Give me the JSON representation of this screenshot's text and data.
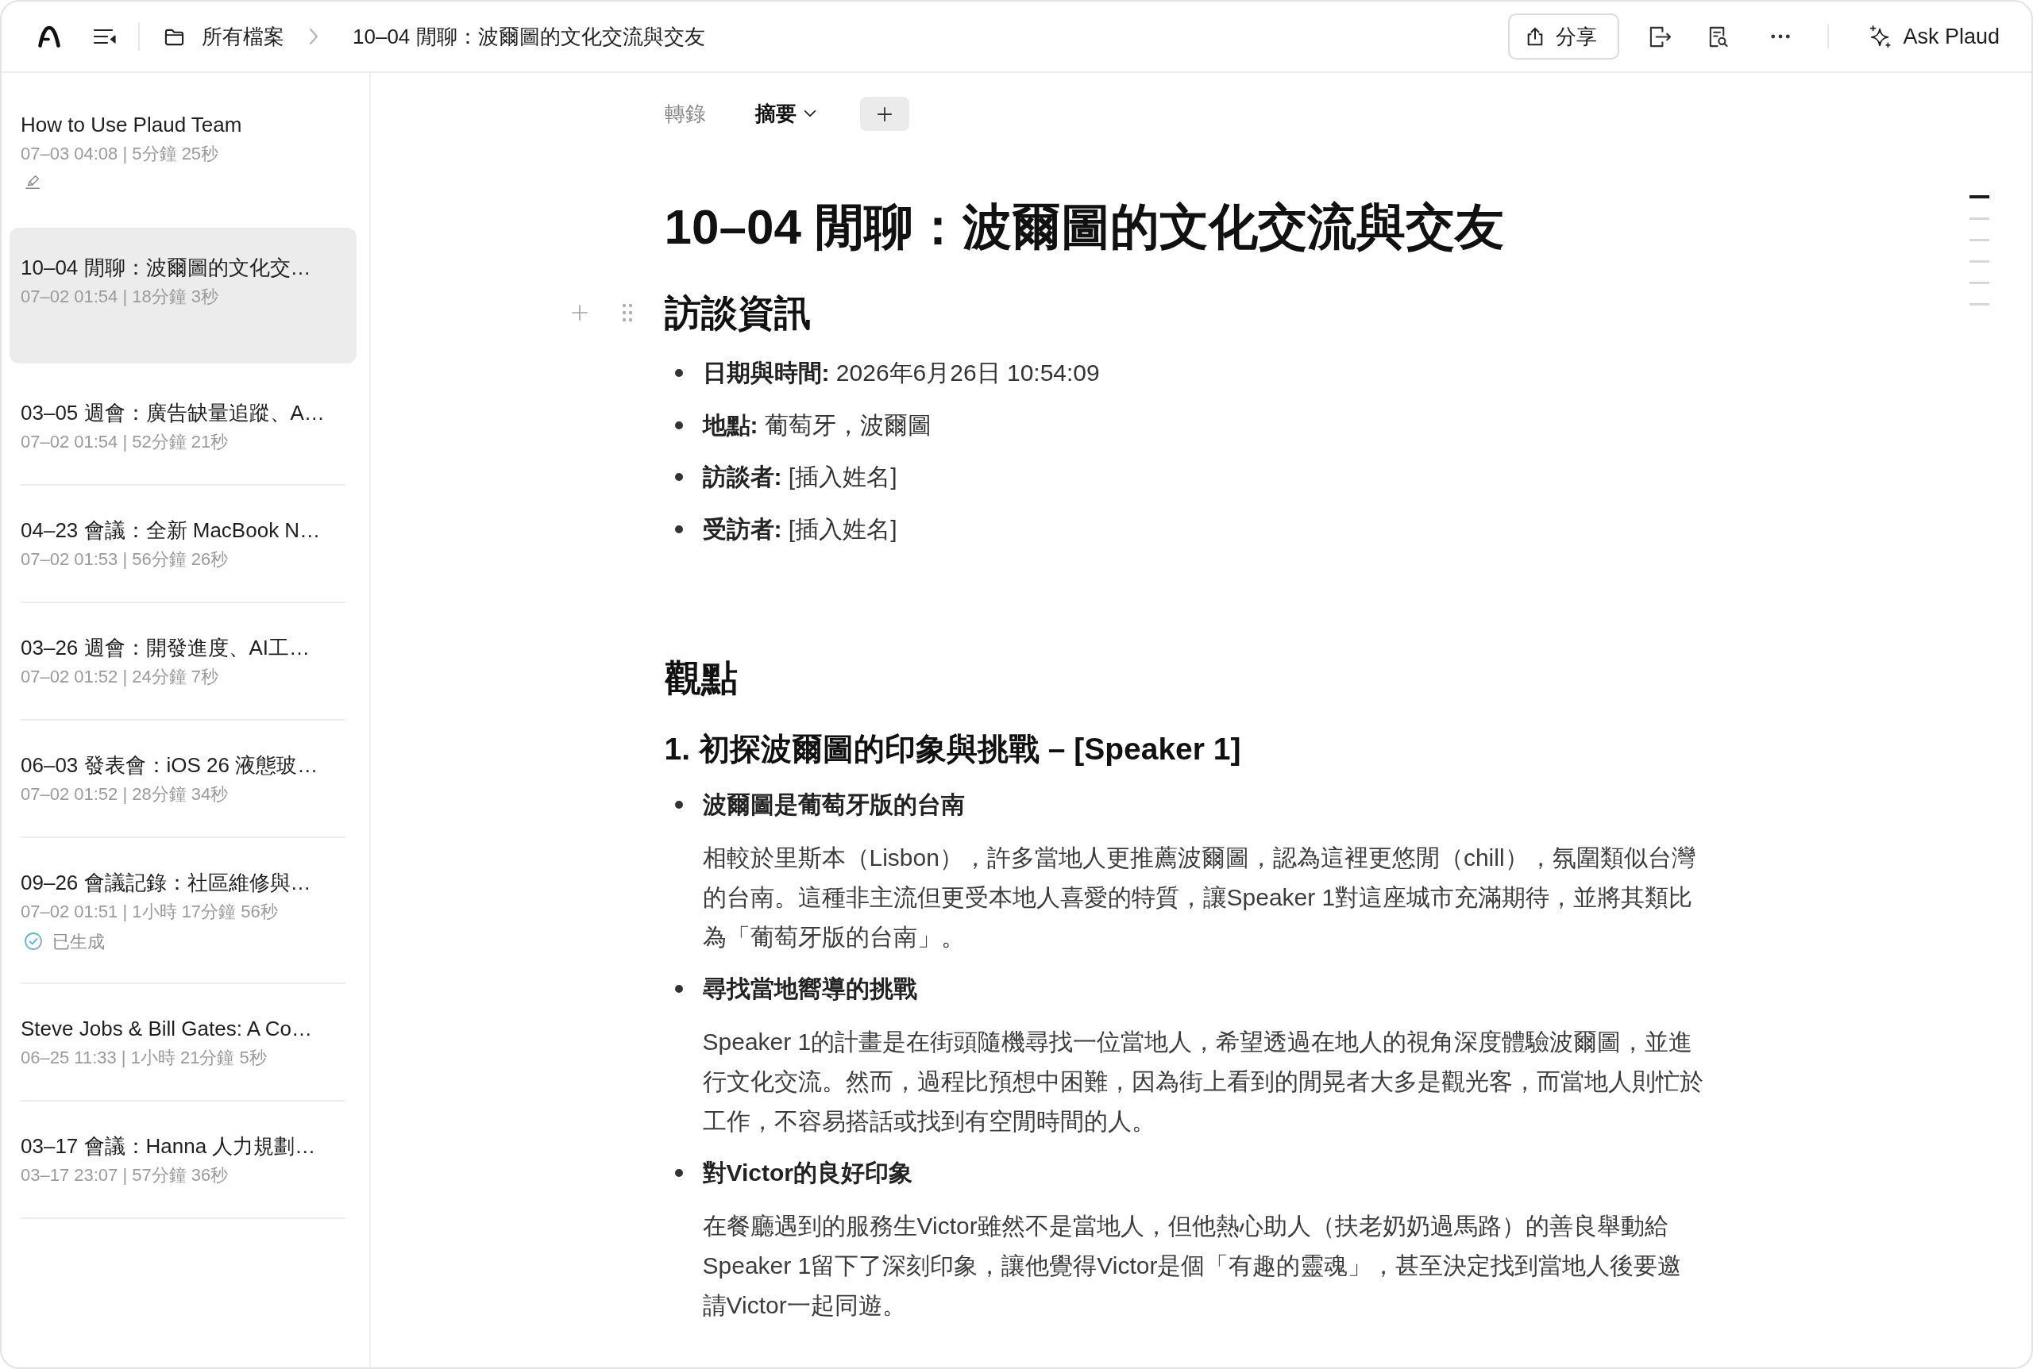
{
  "toolbar": {
    "breadcrumb": [
      {
        "kind": "folder",
        "label": "所有檔案"
      },
      {
        "kind": "page",
        "label": "10–04 閒聊：波爾圖的文化交流與交友"
      }
    ],
    "share_button": "分享",
    "ask_button": "Ask Plaud"
  },
  "sidebar": {
    "items": [
      {
        "title": "How to Use Plaud Team",
        "meta": "07–03 04:08 | 5分鐘 25秒",
        "annotated": true,
        "selected": false
      },
      {
        "title": "10–04 閒聊：波爾圖的文化交…",
        "meta": "07–02 01:54 | 18分鐘 3秒",
        "annotated": false,
        "selected": true
      },
      {
        "title": "03–05 週會：廣告缺量追蹤、A…",
        "meta": "07–02 01:54 | 52分鐘 21秒",
        "annotated": false,
        "selected": false
      },
      {
        "title": "04–23 會議：全新 MacBook N…",
        "meta": "07–02 01:53 | 56分鐘 26秒",
        "annotated": false,
        "selected": false
      },
      {
        "title": "03–26 週會：開發進度、AI工…",
        "meta": "07–02 01:52 | 24分鐘 7秒",
        "annotated": false,
        "selected": false
      },
      {
        "title": "06–03 發表會：iOS 26 液態玻…",
        "meta": "07–02 01:52 | 28分鐘 34秒",
        "annotated": false,
        "selected": false
      },
      {
        "title": "09–26 會議記錄：社區維修與…",
        "meta": "07–02 01:51 | 1小時 17分鐘 56秒",
        "status": "已生成",
        "annotated": false,
        "selected": false
      },
      {
        "title": "Steve Jobs & Bill Gates: A Co…",
        "meta": "06–25 11:33 | 1小時 21分鐘 5秒",
        "annotated": false,
        "selected": false
      },
      {
        "title": "03–17 會議：Hanna 人力規劃…",
        "meta": "03–17 23:07 | 57分鐘 36秒",
        "annotated": false,
        "selected": false
      }
    ]
  },
  "document": {
    "tabs": [
      {
        "label": "轉錄",
        "selected": false,
        "dropdown": false
      },
      {
        "label": "摘要",
        "selected": true,
        "dropdown": true
      }
    ],
    "title": "10–04 閒聊：波爾圖的文化交流與交友",
    "blocks": [
      {
        "kind": "heading",
        "text": "訪談資訊",
        "hovered": true
      },
      {
        "kind": "field_list",
        "hovered": false,
        "items": [
          "**日期與時間:** 2026年6月26日 10:54:09",
          "**地點:** 葡萄牙，波爾圖",
          "**訪談者:** [插入姓名]",
          "**受訪者:** [插入姓名]"
        ]
      },
      {
        "kind": "heading",
        "text": "觀點",
        "hovered": false
      },
      {
        "kind": "subheading",
        "text": "1. 初探波爾圖的印象與挑戰 – [Speaker 1]",
        "hovered": false
      },
      {
        "kind": "point_list",
        "hovered": false,
        "items": [
          {
            "title": "波爾圖是葡萄牙版的台南",
            "body": "相較於里斯本（Lisbon），許多當地人更推薦波爾圖，認為這裡更悠閒（chill），氛圍類似台灣的台南。這種非主流但更受本地人喜愛的特質，讓Speaker 1對這座城市充滿期待，並將其類比為「葡萄牙版的台南」。"
          },
          {
            "title": "尋找當地嚮導的挑戰",
            "body": "Speaker 1的計畫是在街頭隨機尋找一位當地人，希望透過在地人的視角深度體驗波爾圖，並進行文化交流。然而，過程比預想中困難，因為街上看到的閒晃者大多是觀光客，而當地人則忙於工作，不容易搭話或找到有空閒時間的人。"
          },
          {
            "title": "對Victor的良好印象",
            "body": "在餐廳遇到的服務生Victor雖然不是當地人，但他熱心助人（扶老奶奶過馬路）的善良舉動給Speaker 1留下了深刻印象，讓他覺得Victor是個「有趣的靈魂」，甚至決定找到當地人後要邀請Victor一起同遊。"
          }
        ]
      }
    ],
    "outline": [
      {
        "selected": true
      },
      {
        "selected": false
      },
      {
        "selected": false
      },
      {
        "selected": false
      },
      {
        "selected": false
      },
      {
        "selected": false
      }
    ]
  }
}
